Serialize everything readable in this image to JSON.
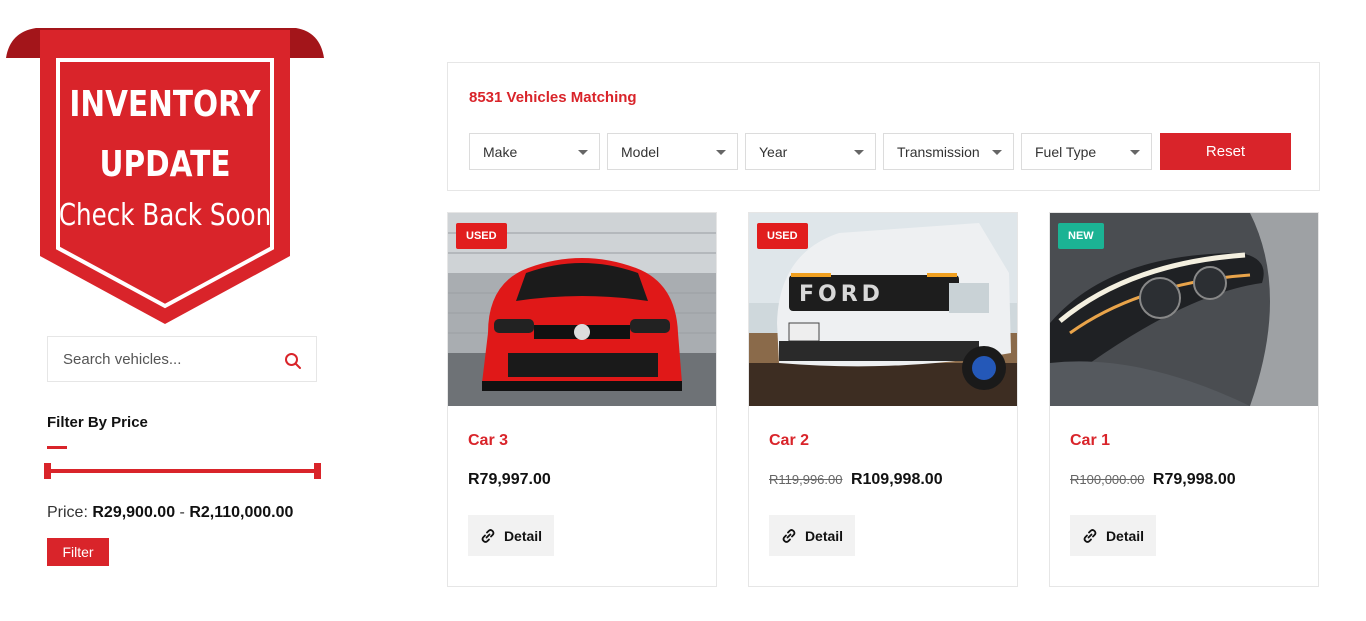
{
  "banner": {
    "line1": "INVENTORY",
    "line2": "UPDATE",
    "line3": "Check Back Soon"
  },
  "sidebar": {
    "search_placeholder": "Search vehicles...",
    "search_icon": "search-icon",
    "filter_title": "Filter By Price",
    "price_label": "Price:",
    "price_min": "R29,900.00",
    "price_separator": "-",
    "price_max": "R2,110,000.00",
    "filter_button": "Filter"
  },
  "filters": {
    "match_count": "8531 Vehicles Matching",
    "selects": [
      "Make",
      "Model",
      "Year",
      "Transmission",
      "Fuel Type"
    ],
    "reset_button": "Reset"
  },
  "cards": [
    {
      "badge": "USED",
      "badge_color": "#e11d1d",
      "title": "Car 3",
      "old_price": "",
      "price": "R79,997.00",
      "detail": "Detail"
    },
    {
      "badge": "USED",
      "badge_color": "#e11d1d",
      "title": "Car 2",
      "old_price": "R119,996.00",
      "price": "R109,998.00",
      "detail": "Detail"
    },
    {
      "badge": "NEW",
      "badge_color": "#1bb394",
      "title": "Car 1",
      "old_price": "R100,000.00",
      "price": "R79,998.00",
      "detail": "Detail"
    }
  ],
  "colors": {
    "accent": "#d9242a",
    "new_badge": "#1bb394"
  }
}
